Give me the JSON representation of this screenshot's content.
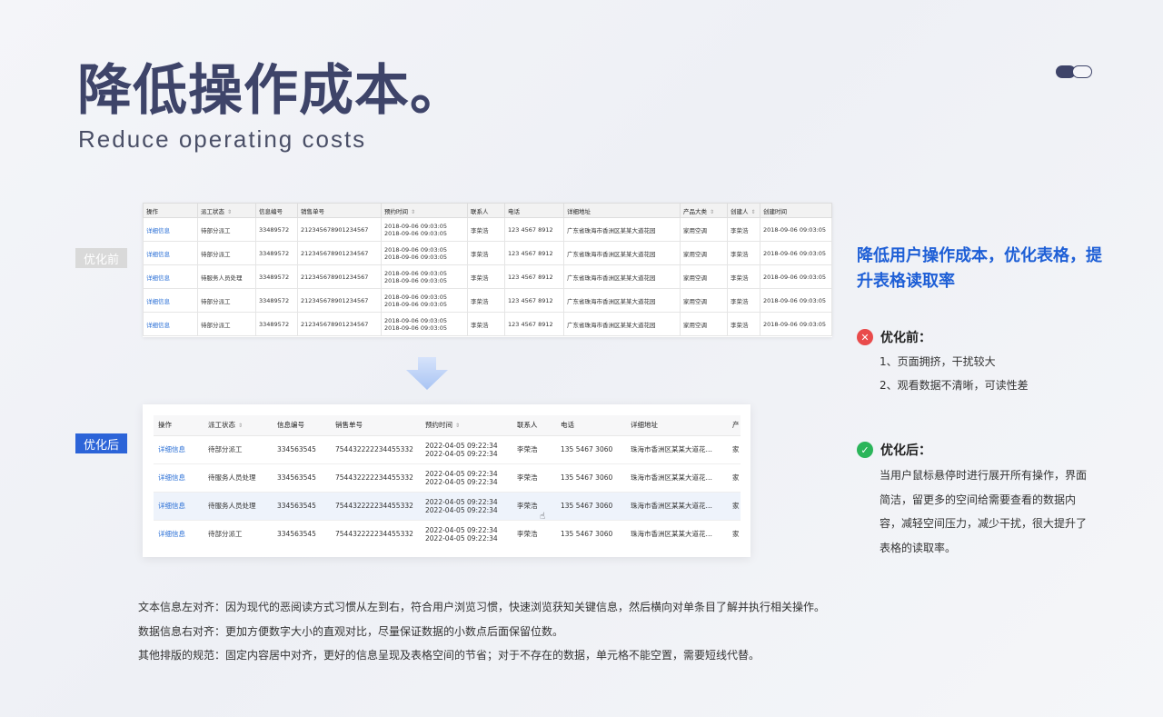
{
  "header": {
    "title": "降低操作成本。",
    "subtitle": "Reduce operating costs"
  },
  "labels": {
    "before": "优化前",
    "after": "优化后"
  },
  "before_table": {
    "columns": [
      "操作",
      "派工状态",
      "信息编号",
      "销售单号",
      "预约时间",
      "联系人",
      "电话",
      "详细地址",
      "产品大类",
      "创建人",
      "创建时间"
    ],
    "rows": [
      {
        "action": "详细信息",
        "status": "待部分派工",
        "info_no": "33489572",
        "sales_no": "212345678901234567",
        "time1": "2018-09-06  09:03:05",
        "time2": "2018-09-06  09:03:05",
        "contact": "李荣浩",
        "phone": "123 4567 8912",
        "address": "广东省珠海市香洲区某某大道花园",
        "category": "家用空调",
        "creator": "李荣浩",
        "created": "2018-09-06  09:03:05"
      },
      {
        "action": "详细信息",
        "status": "待部分派工",
        "info_no": "33489572",
        "sales_no": "212345678901234567",
        "time1": "2018-09-06  09:03:05",
        "time2": "2018-09-06  09:03:05",
        "contact": "李荣浩",
        "phone": "123 4567 8912",
        "address": "广东省珠海市香洲区某某大道花园",
        "category": "家用空调",
        "creator": "李荣浩",
        "created": "2018-09-06  09:03:05"
      },
      {
        "action": "详细信息",
        "status": "待服务人员处理",
        "info_no": "33489572",
        "sales_no": "212345678901234567",
        "time1": "2018-09-06  09:03:05",
        "time2": "2018-09-06  09:03:05",
        "contact": "李荣浩",
        "phone": "123 4567 8912",
        "address": "广东省珠海市香洲区某某大道花园",
        "category": "家用空调",
        "creator": "李荣浩",
        "created": "2018-09-06  09:03:05"
      },
      {
        "action": "详细信息",
        "status": "待部分派工",
        "info_no": "33489572",
        "sales_no": "212345678901234567",
        "time1": "2018-09-06  09:03:05",
        "time2": "2018-09-06  09:03:05",
        "contact": "李荣浩",
        "phone": "123 4567 8912",
        "address": "广东省珠海市香洲区某某大道花园",
        "category": "家用空调",
        "creator": "李荣浩",
        "created": "2018-09-06  09:03:05"
      },
      {
        "action": "详细信息",
        "status": "待部分派工",
        "info_no": "33489572",
        "sales_no": "212345678901234567",
        "time1": "2018-09-06  09:03:05",
        "time2": "2018-09-06  09:03:05",
        "contact": "李荣浩",
        "phone": "123 4567 8912",
        "address": "广东省珠海市香洲区某某大道花园",
        "category": "家用空调",
        "creator": "李荣浩",
        "created": "2018-09-06  09:03:05"
      }
    ]
  },
  "after_table": {
    "columns": [
      "操作",
      "派工状态",
      "信息编号",
      "销售单号",
      "预约时间",
      "联系人",
      "电话",
      "详细地址",
      "产"
    ],
    "rows": [
      {
        "action": "详细信息",
        "status": "待部分派工",
        "info_no": "334563545",
        "sales_no": "75443222223445533​2",
        "time1": "2022-04-05 09:22:34",
        "time2": "2022-04-05 09:22:34",
        "contact": "李荣浩",
        "phone": "135 5467 3060",
        "address": "珠海市香洲区某某大道花…",
        "cut": "家"
      },
      {
        "action": "详细信息",
        "status": "待服务人员处理",
        "info_no": "334563545",
        "sales_no": "754432222234455332",
        "time1": "2022-04-05 09:22:34",
        "time2": "2022-04-05 09:22:34",
        "contact": "李荣浩",
        "phone": "135 5467 3060",
        "address": "珠海市香洲区某某大道花…",
        "cut": "家"
      },
      {
        "action": "详细信息",
        "status": "待服务人员处理",
        "info_no": "334563545",
        "sales_no": "754432222234455332",
        "time1": "2022-04-05 09:22:34",
        "time2": "2022-04-05 09:22:34",
        "contact": "李荣浩",
        "phone": "135 5467 3060",
        "address": "珠海市香洲区某某大道花…",
        "cut": "家"
      },
      {
        "action": "详细信息",
        "status": "待部分派工",
        "info_no": "334563545",
        "sales_no": "754432222234455332",
        "time1": "2022-04-05 09:22:34",
        "time2": "2022-04-05 09:22:34",
        "contact": "李荣浩",
        "phone": "135 5467 3060",
        "address": "珠海市香洲区某某大道花…",
        "cut": "家"
      }
    ]
  },
  "right_panel": {
    "heading": "降低用户操作成本，优化表格，提升表格读取率",
    "before_title": "优化前：",
    "before_items": [
      "1、页面拥挤，干扰较大",
      "2、观看数据不清晰，可读性差"
    ],
    "after_title": "优化后：",
    "after_text": "当用户鼠标悬停时进行展开所有操作，界面简洁，留更多的空间给需要查看的数据内容，减轻空间压力，减少干扰，很大提升了表格的读取率。"
  },
  "bottom_notes": [
    "文本信息左对齐：因为现代的恶阅读方式习惯从左到右，符合用户浏览习惯，快速浏览获知关键信息，然后横向对单条目了解并执行相关操作。",
    "数据信息右对齐：更加方便数字大小的直观对比，尽量保证数据的小数点后面保留位数。",
    "其他排版的规范：固定内容居中对齐，更好的信息呈现及表格空间的节省；对于不存在的数据，单元格不能空置，需要短线代替。"
  ],
  "colors": {
    "title": "#3e4469",
    "accent": "#1e5fd6",
    "link": "#2a6fd6",
    "error": "#e94b4b",
    "success": "#2bb55a"
  },
  "icons": {
    "toggle": "toggle-icon",
    "arrow": "arrow-down-icon",
    "error": "close-circle-icon",
    "success": "check-circle-icon",
    "sort": "sort-icon",
    "cursor": "hand-pointer-icon"
  }
}
